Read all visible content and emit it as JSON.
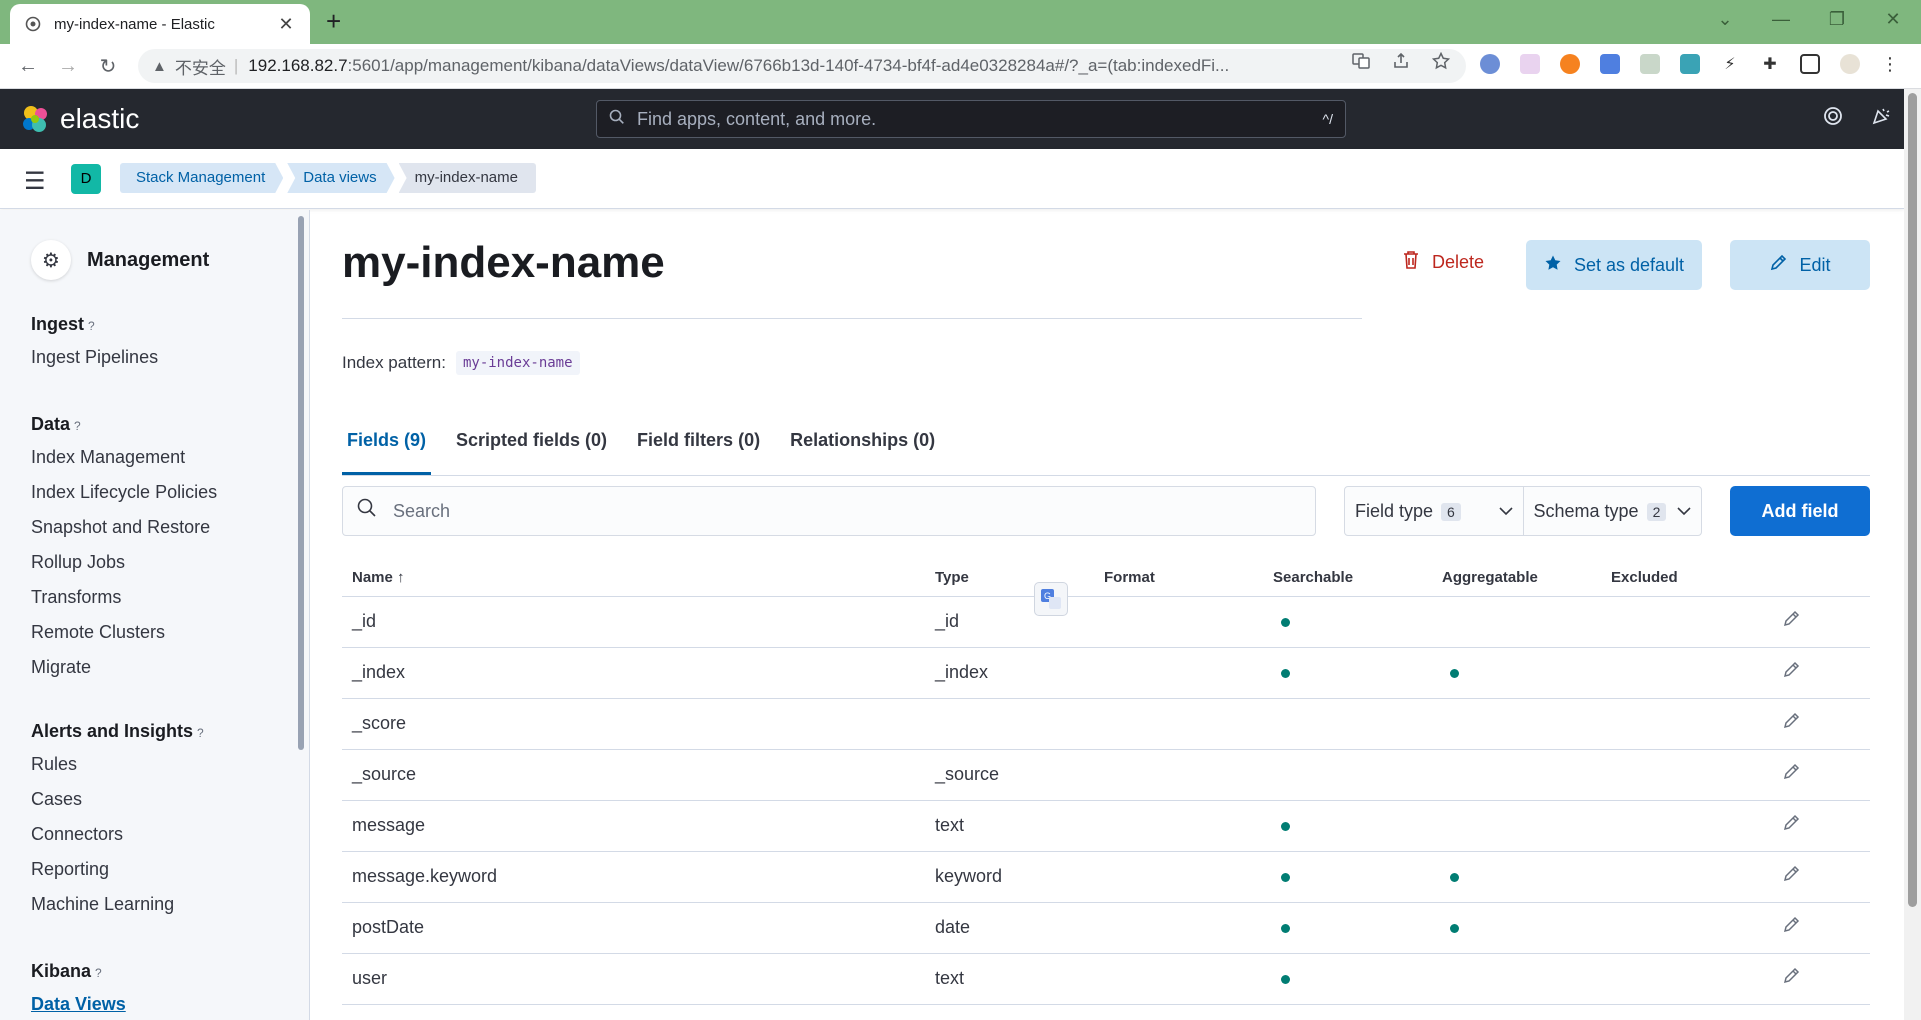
{
  "browser": {
    "tab_title": "my-index-name - Elastic",
    "close_glyph": "✕",
    "new_tab_glyph": "+",
    "window_buttons": [
      "⌄",
      "—",
      "❐",
      "✕"
    ],
    "security_label": "不安全",
    "separator": "|",
    "url_host": "192.168.82.7",
    "url_path": ":5601/app/management/kibana/dataViews/dataView/6766b13d-140f-4734-bf4f-ad4e0328284a#/?_a=(tab:indexedFi...",
    "back_glyph": "←",
    "forward_glyph": "→",
    "reload_glyph": "↻"
  },
  "kibana": {
    "brand": "elastic",
    "search_placeholder": "Find apps, content, and more.",
    "search_shortcut": "^/"
  },
  "breadcrumbs": [
    {
      "label": "Stack Management"
    },
    {
      "label": "Data views"
    },
    {
      "label": "my-index-name"
    }
  ],
  "space_initial": "D",
  "sidebar": {
    "title": "Management",
    "groups": [
      {
        "heading": "Ingest",
        "items": [
          "Ingest Pipelines"
        ]
      },
      {
        "heading": "Data",
        "items": [
          "Index Management",
          "Index Lifecycle Policies",
          "Snapshot and Restore",
          "Rollup Jobs",
          "Transforms",
          "Remote Clusters",
          "Migrate"
        ]
      },
      {
        "heading": "Alerts and Insights",
        "items": [
          "Rules",
          "Cases",
          "Connectors",
          "Reporting",
          "Machine Learning"
        ]
      },
      {
        "heading": "Kibana",
        "items": [
          "Data Views"
        ]
      }
    ],
    "help_glyph": "?"
  },
  "page": {
    "title": "my-index-name",
    "delete_label": "Delete",
    "set_default_label": "Set as default",
    "edit_label": "Edit",
    "index_pattern_label": "Index pattern:",
    "index_pattern_value": "my-index-name",
    "tabs": [
      "Fields (9)",
      "Scripted fields (0)",
      "Field filters (0)",
      "Relationships (0)"
    ],
    "search_placeholder": "Search",
    "field_type_label": "Field type",
    "field_type_count": "6",
    "schema_type_label": "Schema type",
    "schema_type_count": "2",
    "add_field_label": "Add field"
  },
  "table": {
    "columns": [
      "Name",
      "Type",
      "Format",
      "Searchable",
      "Aggregatable",
      "Excluded"
    ],
    "sort_glyph": "↑",
    "rows": [
      {
        "name": "_id",
        "type": "_id",
        "format": "",
        "searchable": true,
        "aggregatable": false,
        "excluded": false
      },
      {
        "name": "_index",
        "type": "_index",
        "format": "",
        "searchable": true,
        "aggregatable": true,
        "excluded": false
      },
      {
        "name": "_score",
        "type": "",
        "format": "",
        "searchable": false,
        "aggregatable": false,
        "excluded": false
      },
      {
        "name": "_source",
        "type": "_source",
        "format": "",
        "searchable": false,
        "aggregatable": false,
        "excluded": false
      },
      {
        "name": "message",
        "type": "text",
        "format": "",
        "searchable": true,
        "aggregatable": false,
        "excluded": false
      },
      {
        "name": "message.keyword",
        "type": "keyword",
        "format": "",
        "searchable": true,
        "aggregatable": true,
        "excluded": false
      },
      {
        "name": "postDate",
        "type": "date",
        "format": "",
        "searchable": true,
        "aggregatable": true,
        "excluded": false
      },
      {
        "name": "user",
        "type": "text",
        "format": "",
        "searchable": true,
        "aggregatable": false,
        "excluded": false
      }
    ]
  },
  "colors": {
    "tabstrip": "#7fb77e",
    "kibana_header": "#25282f",
    "accent": "#0f6ed2",
    "dot": "#017d73",
    "danger": "#bd271e"
  },
  "icons": [
    "elastic-favicon",
    "warning-icon",
    "translate-icon",
    "share-icon",
    "star-icon",
    "extension-icon",
    "help-icon",
    "news-icon",
    "gear-icon",
    "trash-icon",
    "pencil-icon",
    "search-icon",
    "chevron-down-icon"
  ]
}
